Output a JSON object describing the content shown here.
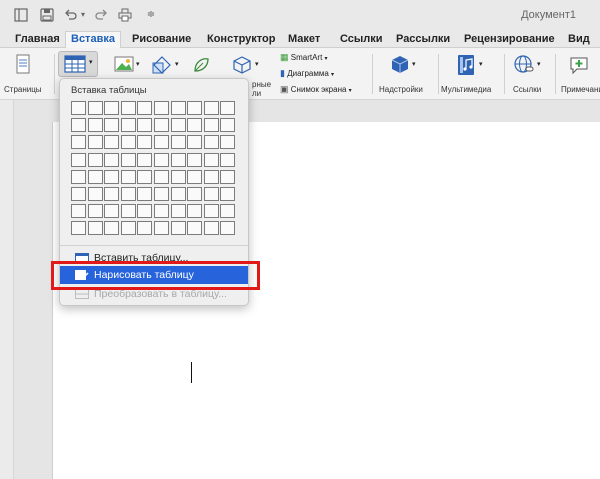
{
  "window": {
    "title": "Документ1"
  },
  "quick_access": [
    "sidebar-icon",
    "save-icon",
    "undo-icon",
    "redo-icon",
    "print-icon",
    "customize-icon"
  ],
  "tabs": [
    {
      "label": "Главная",
      "active": false
    },
    {
      "label": "Вставка",
      "active": true
    },
    {
      "label": "Рисование",
      "active": false
    },
    {
      "label": "Конструктор",
      "active": false
    },
    {
      "label": "Макет",
      "active": false
    },
    {
      "label": "Ссылки",
      "active": false
    },
    {
      "label": "Рассылки",
      "active": false
    },
    {
      "label": "Рецензирование",
      "active": false
    },
    {
      "label": "Вид",
      "active": false
    }
  ],
  "ribbon": {
    "pages_label": "Страницы",
    "illustrations_label_partial_1": "рные",
    "illustrations_label_partial_2": "ли",
    "smartart_label": "SmartArt",
    "chart_label": "Диаграмма",
    "screenshot_label": "Снимок экрана",
    "addins_label": "Надстройки",
    "media_label": "Мультимедиа",
    "links_label": "Ссылки",
    "comment_label": "Примечание"
  },
  "table_menu": {
    "title": "Вставка таблицы",
    "grid_cols": 10,
    "grid_rows": 8,
    "items": [
      {
        "label": "Вставить таблицу...",
        "state": "normal"
      },
      {
        "label": "Нарисовать таблицу",
        "state": "highlighted"
      },
      {
        "label": "Преобразовать в таблицу...",
        "state": "disabled"
      }
    ]
  },
  "colors": {
    "accent": "#1d5fb8",
    "highlight": "#2763db",
    "annotation": "#e11919"
  }
}
